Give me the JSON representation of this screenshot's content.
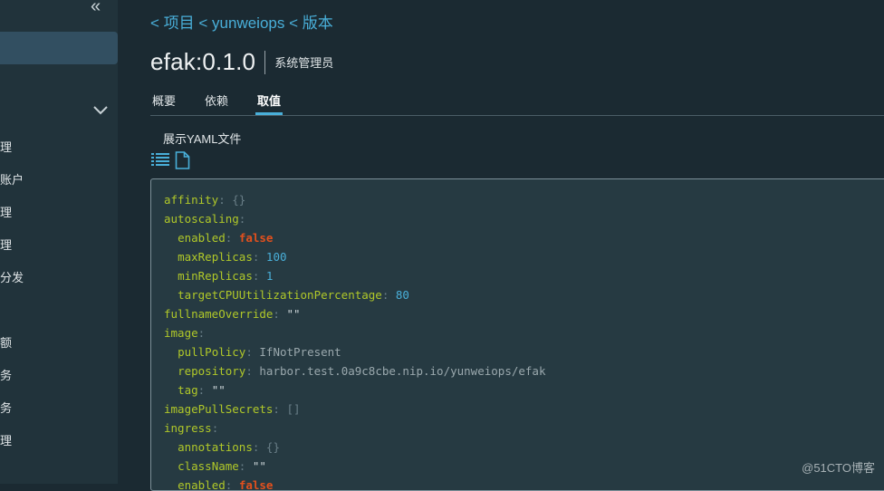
{
  "sidebar": {
    "items": [
      "理",
      "账户",
      "理",
      "理",
      "分发",
      "额",
      "务",
      "务",
      "理"
    ]
  },
  "breadcrumb": {
    "items": [
      "< 项目",
      "< yunweiops",
      "< 版本"
    ]
  },
  "header": {
    "title": "efak:0.1.0",
    "owner": "系统管理员"
  },
  "tabs": [
    "概要",
    "依赖",
    "取值"
  ],
  "active_tab": "取值",
  "yaml_toggle_label": "展示YAML文件",
  "code_lines": [
    {
      "indent": "",
      "key": "affinity",
      "value": "{}",
      "type": "p"
    },
    {
      "indent": "",
      "key": "autoscaling",
      "value": "",
      "type": ""
    },
    {
      "indent": "  ",
      "key": "enabled",
      "value": "false",
      "type": "b"
    },
    {
      "indent": "  ",
      "key": "maxReplicas",
      "value": "100",
      "type": "n"
    },
    {
      "indent": "  ",
      "key": "minReplicas",
      "value": "1",
      "type": "n"
    },
    {
      "indent": "  ",
      "key": "targetCPUUtilizationPercentage",
      "value": "80",
      "type": "n"
    },
    {
      "indent": "",
      "key": "fullnameOverride",
      "value": "\"\"",
      "type": "s"
    },
    {
      "indent": "",
      "key": "image",
      "value": "",
      "type": ""
    },
    {
      "indent": "  ",
      "key": "pullPolicy",
      "value": "IfNotPresent",
      "type": "v"
    },
    {
      "indent": "  ",
      "key": "repository",
      "value": "harbor.test.0a9c8cbe.nip.io/yunweiops/efak",
      "type": "v"
    },
    {
      "indent": "  ",
      "key": "tag",
      "value": "\"\"",
      "type": "s"
    },
    {
      "indent": "",
      "key": "imagePullSecrets",
      "value": "[]",
      "type": "p"
    },
    {
      "indent": "",
      "key": "ingress",
      "value": "",
      "type": ""
    },
    {
      "indent": "  ",
      "key": "annotations",
      "value": "{}",
      "type": "p"
    },
    {
      "indent": "  ",
      "key": "className",
      "value": "\"\"",
      "type": "s"
    },
    {
      "indent": "  ",
      "key": "enabled",
      "value": "false",
      "type": "b"
    }
  ],
  "watermark": "@51CTO博客",
  "colors": {
    "accent": "#49afd9",
    "key": "#b0c829",
    "number": "#49afd9",
    "boolean": "#e2501d",
    "background": "#1b2a32",
    "sidebar": "#21333b"
  }
}
